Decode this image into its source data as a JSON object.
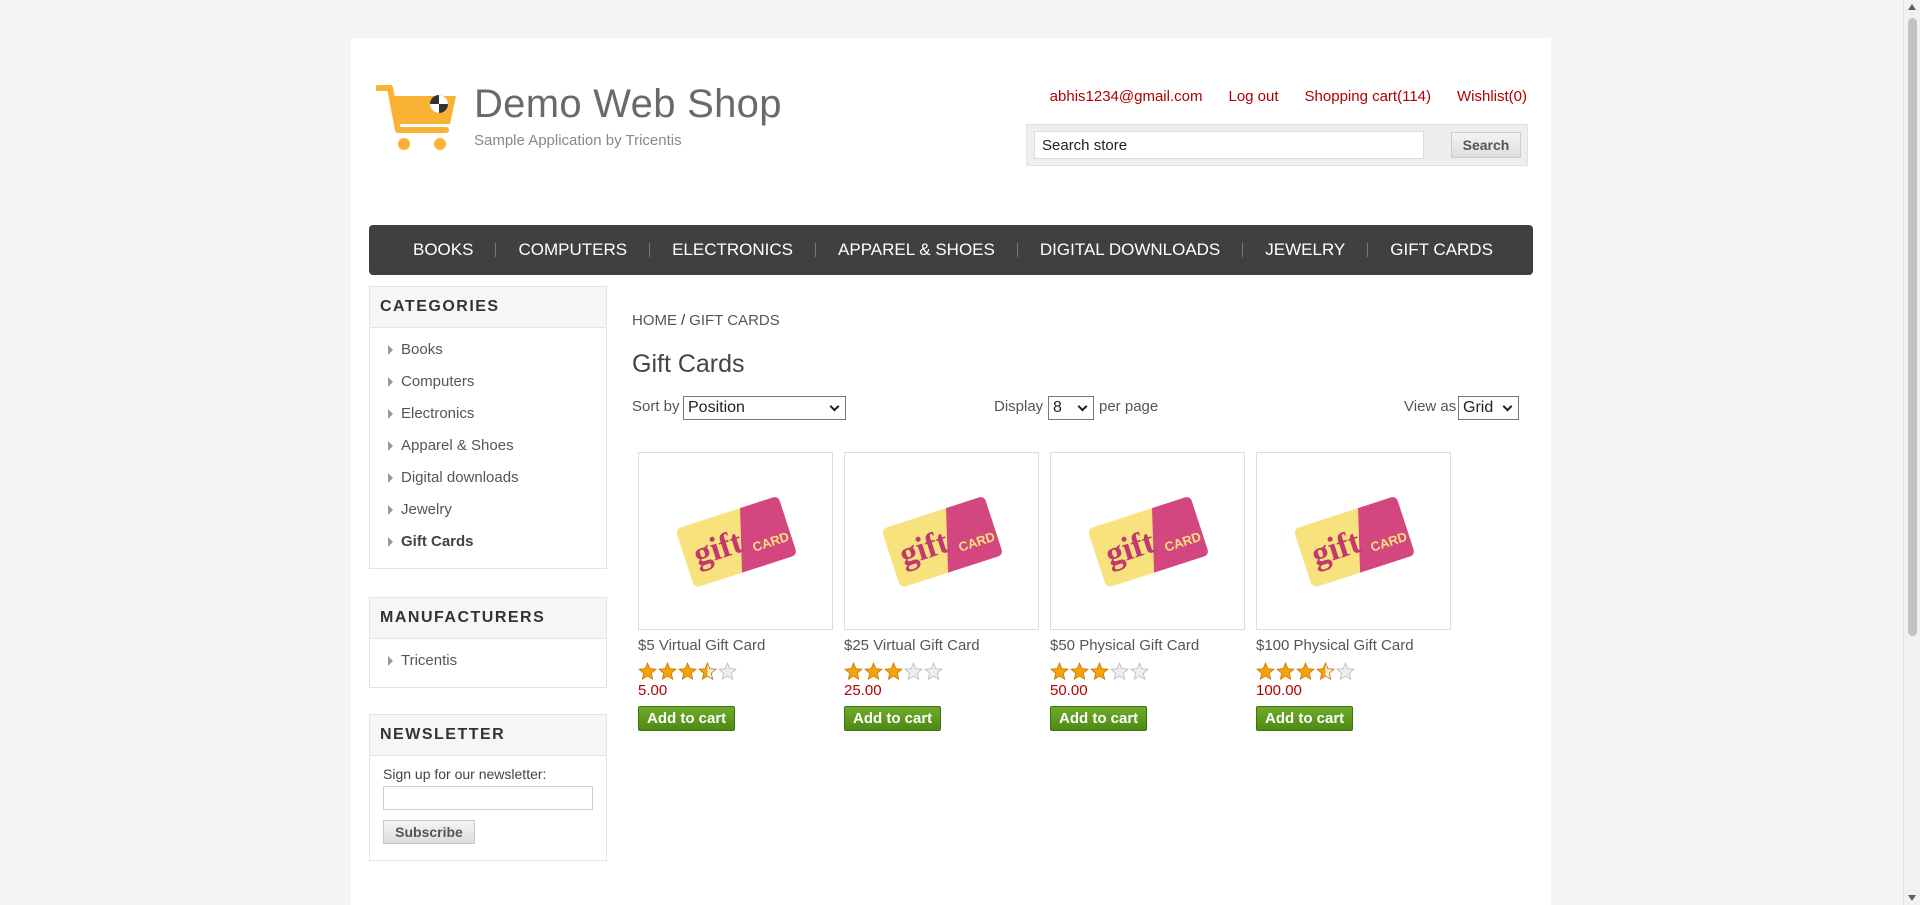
{
  "header": {
    "logo_title": "Demo Web Shop",
    "logo_subtitle": "Sample Application by Tricentis",
    "links": {
      "account": "abhis1234@gmail.com",
      "logout": "Log out",
      "cart": "Shopping cart(114)",
      "wishlist": "Wishlist(0)"
    },
    "search": {
      "value": "Search store",
      "button": "Search"
    }
  },
  "top_menu": [
    "BOOKS",
    "COMPUTERS",
    "ELECTRONICS",
    "APPAREL & SHOES",
    "DIGITAL DOWNLOADS",
    "JEWELRY",
    "GIFT CARDS"
  ],
  "sidebar": {
    "categories_title": "CATEGORIES",
    "categories": [
      "Books",
      "Computers",
      "Electronics",
      "Apparel & Shoes",
      "Digital downloads",
      "Jewelry",
      "Gift Cards"
    ],
    "active_category": "Gift Cards",
    "manufacturers_title": "MANUFACTURERS",
    "manufacturers": [
      "Tricentis"
    ],
    "newsletter_title": "NEWSLETTER",
    "newsletter_label": "Sign up for our newsletter:",
    "subscribe_button": "Subscribe"
  },
  "breadcrumb": {
    "home": "HOME",
    "separator": "/",
    "current": "GIFT CARDS"
  },
  "page_title": "Gift Cards",
  "toolbar": {
    "sort_label": "Sort by",
    "sort_value": "Position",
    "display_label": "Display",
    "display_value": "8",
    "per_page_label": "per page",
    "view_label": "View as",
    "view_value": "Grid"
  },
  "products": [
    {
      "title": "$5 Virtual Gift Card",
      "price": "5.00",
      "rating": 3.5,
      "button": "Add to cart"
    },
    {
      "title": "$25 Virtual Gift Card",
      "price": "25.00",
      "rating": 3,
      "button": "Add to cart"
    },
    {
      "title": "$50 Physical Gift Card",
      "price": "50.00",
      "rating": 3,
      "button": "Add to cart"
    },
    {
      "title": "$100 Physical Gift Card",
      "price": "100.00",
      "rating": 3.5,
      "button": "Add to cart"
    }
  ],
  "colors": {
    "link_red": "#b00000",
    "menu_bg": "#404040",
    "cart_green": "#5a9a1c",
    "logo_orange": "#f9b233",
    "star": "#f5a20a"
  }
}
